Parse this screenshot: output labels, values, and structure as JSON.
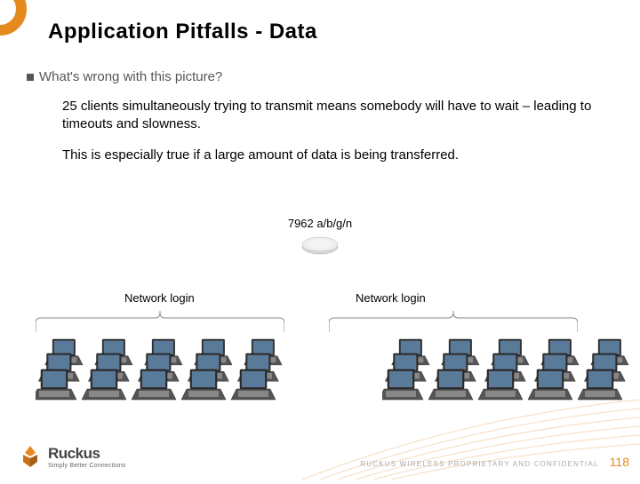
{
  "title": "Application Pitfalls - Data",
  "bullet": "What's wrong with this picture?",
  "body": {
    "p1": "25 clients simultaneously trying to transmit means somebody will have to wait – leading to timeouts and slowness.",
    "p2": "This is especially true if a large amount of data is being transferred."
  },
  "ap_label": "7962 a/b/g/n",
  "login_left": "Network login",
  "login_right": "Network login",
  "logo": {
    "name": "Ruckus",
    "tagline": "Simply Better Connections"
  },
  "footer": {
    "confidential": "RUCKUS WIRELESS PROPRIETARY AND CONFIDENTIAL",
    "page": "118"
  }
}
